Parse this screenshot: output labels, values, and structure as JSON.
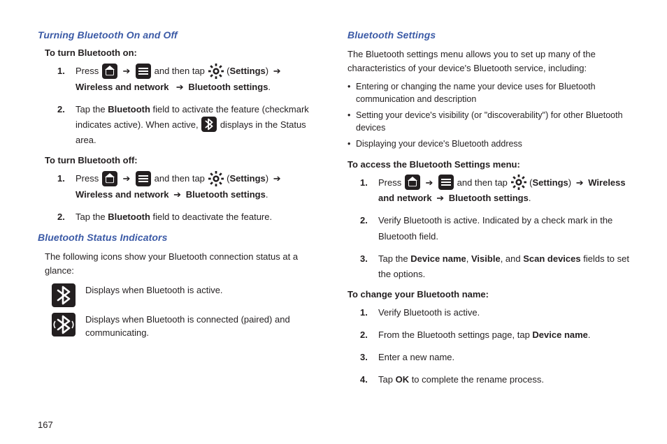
{
  "pageNumber": "167",
  "left": {
    "h1": "Turning Bluetooth On and Off",
    "on_head": "To turn Bluetooth on:",
    "on_steps": {
      "s1_press": "Press ",
      "s1_andtap": " and then tap ",
      "s1_settings": "Settings",
      "s1_wnet": "Wireless and network",
      "s1_bts": "Bluetooth settings",
      "s2_a": "Tap the ",
      "s2_bt": "Bluetooth",
      "s2_b": " field to activate the feature (checkmark indicates active). When active, ",
      "s2_c": " displays in the Status area."
    },
    "off_head": "To turn Bluetooth off:",
    "off_steps": {
      "s1_press": "Press ",
      "s1_andtap": " and then tap ",
      "s1_settings": "Settings",
      "s1_wnet": "Wireless and network",
      "s1_bts": "Bluetooth settings",
      "s2_a": "Tap the ",
      "s2_bt": "Bluetooth",
      "s2_b": " field to deactivate the feature."
    },
    "h2": "Bluetooth Status Indicators",
    "status_intro": "The following icons show your Bluetooth connection status at a glance:",
    "status1": "Displays when Bluetooth is active.",
    "status2": "Displays when Bluetooth is connected (paired) and communicating."
  },
  "right": {
    "h1": "Bluetooth Settings",
    "intro": "The Bluetooth settings menu allows you to set up many of the characteristics of your device's Bluetooth service, including:",
    "bullets": [
      "Entering or changing the name your device uses for Bluetooth communication and description",
      "Setting your device's visibility (or \"discoverability\") for other Bluetooth devices",
      "Displaying your device's Bluetooth address"
    ],
    "access_head": "To access the Bluetooth Settings menu:",
    "access": {
      "s1_press": "Press ",
      "s1_andtap": " and then tap ",
      "s1_settings": "Settings",
      "s1_wnet": "Wireless and network",
      "s1_bts": "Bluetooth settings",
      "s2": "Verify Bluetooth is active. Indicated by a check mark in the Bluetooth field.",
      "s3_a": "Tap the ",
      "s3_dn": "Device name",
      "s3_c1": ", ",
      "s3_vis": "Visible",
      "s3_c2": ", and ",
      "s3_scan": "Scan devices",
      "s3_b": " fields to set the options."
    },
    "change_head": "To change your Bluetooth name:",
    "change": {
      "s1": "Verify Bluetooth is active.",
      "s2_a": "From the Bluetooth settings page, tap ",
      "s2_dn": "Device name",
      "s3": "Enter a new name.",
      "s4_a": "Tap ",
      "s4_ok": "OK",
      "s4_b": " to complete the rename process."
    }
  }
}
